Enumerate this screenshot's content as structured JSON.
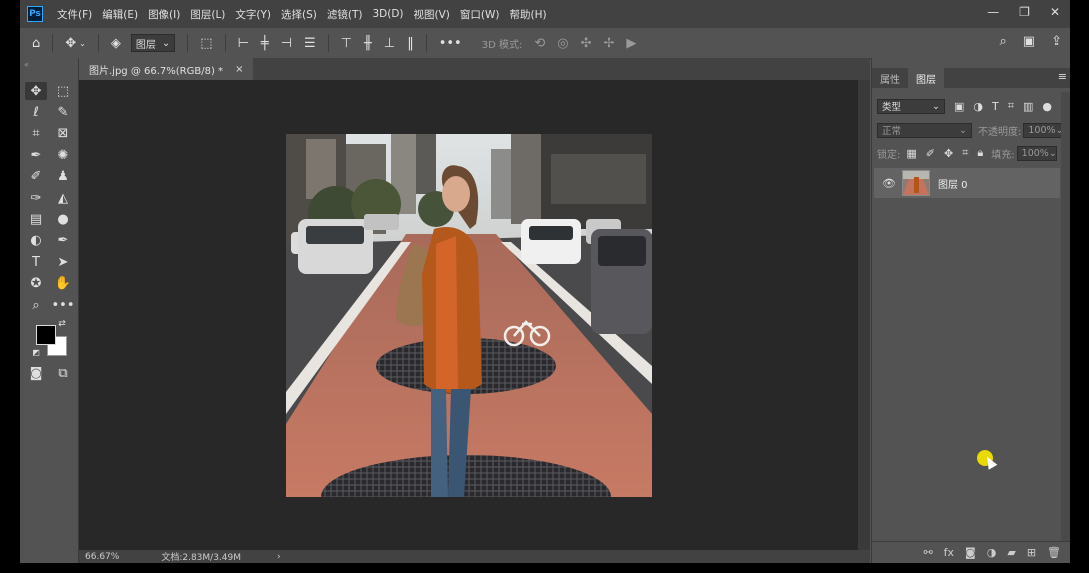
{
  "menubar": {
    "logo": "Ps",
    "items": [
      "文件(F)",
      "编辑(E)",
      "图像(I)",
      "图层(L)",
      "文字(Y)",
      "选择(S)",
      "滤镜(T)",
      "3D(D)",
      "视图(V)",
      "窗口(W)",
      "帮助(H)"
    ],
    "window_controls": [
      "—",
      "❐",
      "✕"
    ]
  },
  "optionsbar": {
    "auto_select_target": "图层",
    "threed_mode_label": "3D 模式:"
  },
  "document": {
    "tab_title": "图片.jpg @ 66.7%(RGB/8) *",
    "tab_close": "×",
    "zoom": "66.67%",
    "doc_size": "文档:2.83M/3.49M",
    "status_arrow": "›"
  },
  "panel": {
    "tabs": [
      "属性",
      "图层"
    ],
    "active_tab": "图层",
    "filter_kind": "类型",
    "blend_mode": "正常",
    "opacity_label": "不透明度:",
    "opacity_value": "100%",
    "lock_label": "锁定:",
    "fill_label": "填充:",
    "fill_value": "100%",
    "layers": [
      {
        "name": "图层 0",
        "visible": true
      }
    ]
  },
  "colors": {
    "foreground": "#000000",
    "background": "#ffffff",
    "accent": "#31a8ff"
  }
}
